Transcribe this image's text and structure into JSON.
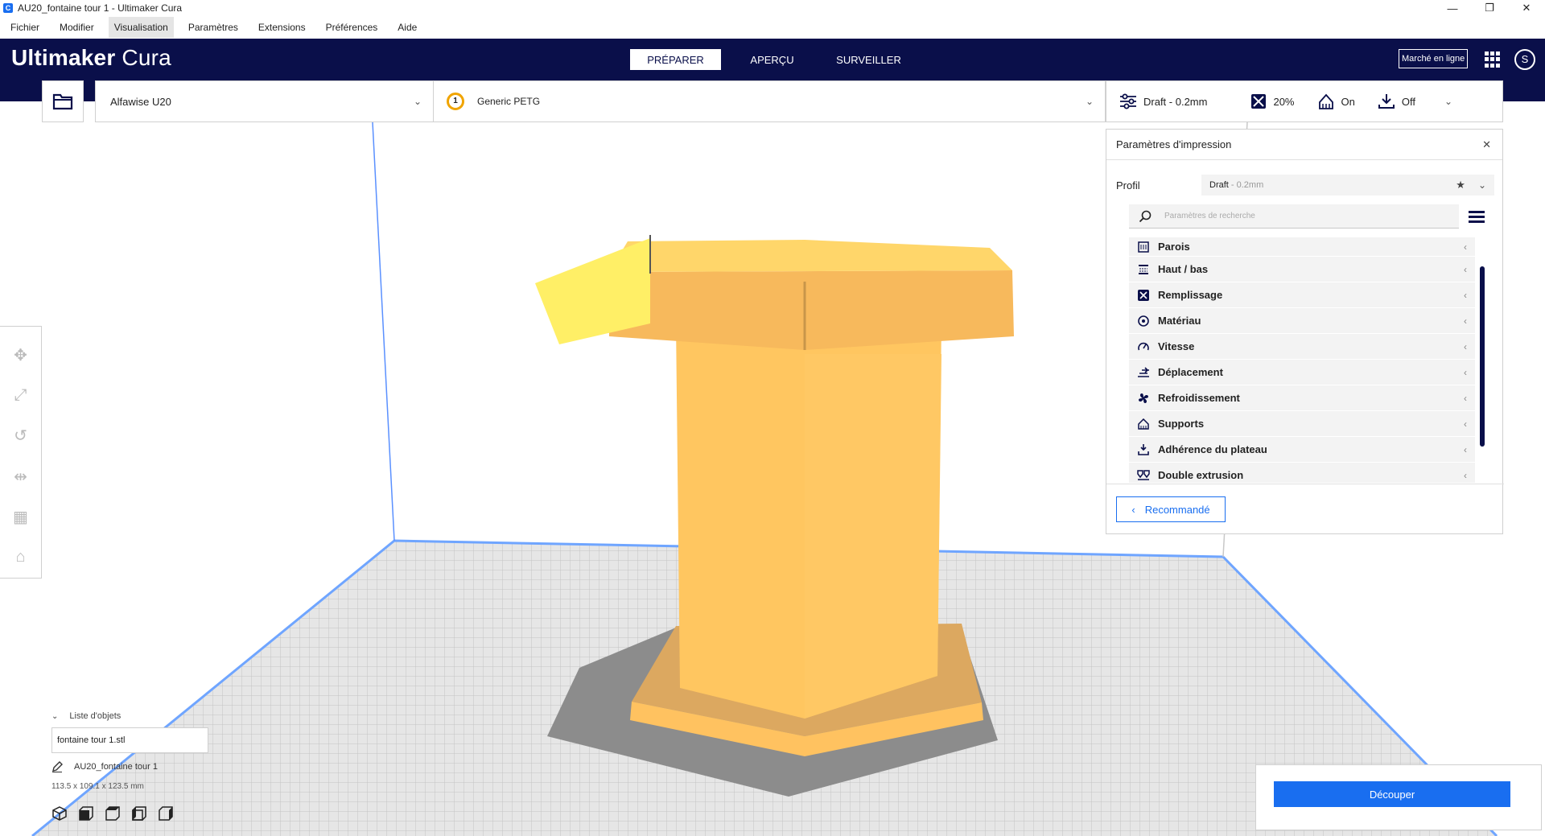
{
  "window": {
    "title": "AU20_fontaine tour 1 - Ultimaker Cura",
    "app_icon": "C",
    "minimize": "—",
    "maximize": "❐",
    "close": "✕"
  },
  "menu": [
    "Fichier",
    "Modifier",
    "Visualisation",
    "Paramètres",
    "Extensions",
    "Préférences",
    "Aide"
  ],
  "header": {
    "logo_brand": "Ultimaker",
    "logo_product": "Cura",
    "stages": [
      "PRÉPARER",
      "APERÇU",
      "SURVEILLER"
    ],
    "marketplace": "Marché en ligne",
    "avatar": "S"
  },
  "printer": {
    "name": "Alfawise U20",
    "extruder_number": "1",
    "material": "Generic PETG"
  },
  "settings_bar": {
    "profile": "Draft - 0.2mm",
    "infill": "20%",
    "support": "On",
    "adhesion": "Off"
  },
  "panel": {
    "title": "Paramètres d'impression",
    "profile_label": "Profil",
    "profile_name": "Draft",
    "profile_suffix": " - 0.2mm",
    "search_placeholder": "Paramètres de recherche",
    "categories": [
      {
        "label": "Parois",
        "icon": "walls-icon"
      },
      {
        "label": "Haut / bas",
        "icon": "top-bottom-icon"
      },
      {
        "label": "Remplissage",
        "icon": "infill-icon"
      },
      {
        "label": "Matériau",
        "icon": "material-icon"
      },
      {
        "label": "Vitesse",
        "icon": "speed-icon"
      },
      {
        "label": "Déplacement",
        "icon": "travel-icon"
      },
      {
        "label": "Refroidissement",
        "icon": "cooling-icon"
      },
      {
        "label": "Supports",
        "icon": "support-icon"
      },
      {
        "label": "Adhérence du plateau",
        "icon": "adhesion-icon"
      },
      {
        "label": "Double extrusion",
        "icon": "dual-extrusion-icon"
      }
    ],
    "recommended": "Recommandé"
  },
  "objects": {
    "heading": "Liste d'objets",
    "file": "fontaine tour 1.stl",
    "job_name": "AU20_fontaine tour 1",
    "dimensions": "113.5 x 109.1 x 123.5 mm"
  },
  "slice": {
    "label": "Découper"
  },
  "colors": {
    "header": "#0a0f4a",
    "accent": "#196ef0",
    "model": "#ffc660",
    "model_side": "#ffb84d",
    "model_overhang": "#fff36a",
    "plate": "#dcdcdc"
  }
}
